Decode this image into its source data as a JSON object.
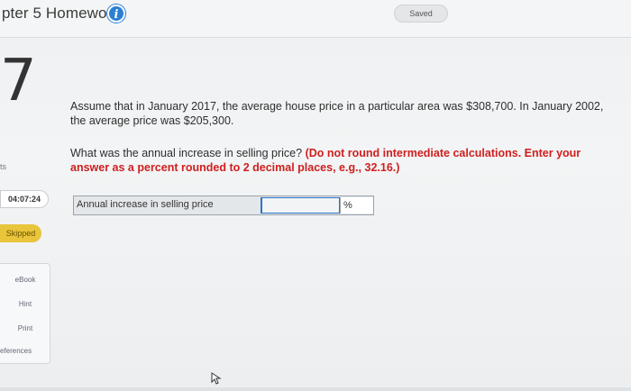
{
  "header": {
    "title": "pter 5 Homework",
    "info_icon": "info-icon",
    "saved_label": "Saved"
  },
  "question": {
    "number": "7",
    "points_fragment": "ts",
    "paragraph1": "Assume that in January 2017, the average house price in a particular area was $308,700. In January 2002, the average price was $205,300.",
    "paragraph2_plain": "What was the annual increase in selling price? ",
    "paragraph2_bold": "(Do not round intermediate calculations. Enter your answer as a percent rounded to 2 decimal places, e.g., 32.16.)"
  },
  "sidebar": {
    "timer": "04:07:24",
    "skipped_label": "Skipped",
    "items": [
      {
        "label": "eBook"
      },
      {
        "label": "Hint"
      },
      {
        "label": "Print"
      },
      {
        "label": "eferences"
      }
    ]
  },
  "answer": {
    "label": "Annual increase in selling price",
    "value": "",
    "placeholder": "",
    "unit": "%"
  },
  "colors": {
    "accent": "#2a7fd4",
    "instruction_red": "#cf1f1f",
    "skipped_yellow": "#e8c53a"
  }
}
